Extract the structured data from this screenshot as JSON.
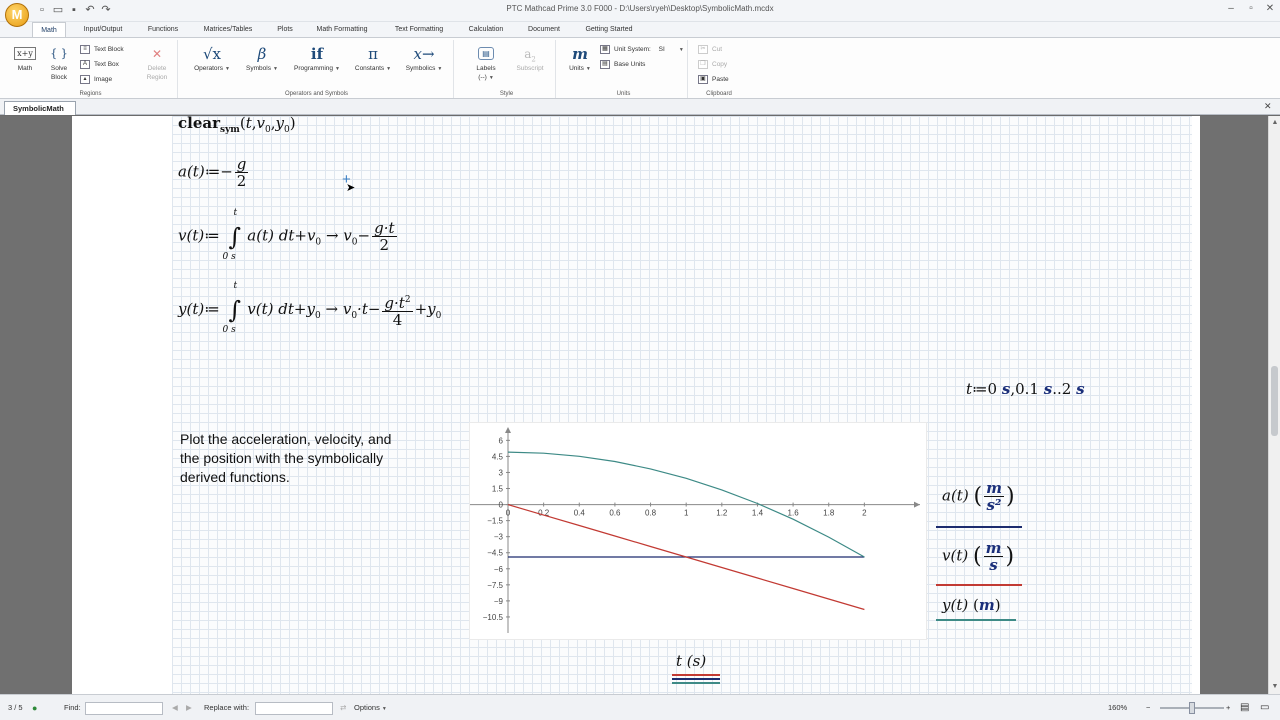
{
  "window": {
    "title": "PTC Mathcad Prime 3.0 F000 - D:\\Users\\ryeh\\Desktop\\SymbolicMath.mcdx",
    "logo": "M",
    "quick_access": [
      "new-icon",
      "open-icon",
      "save-icon",
      "undo-icon",
      "redo-icon"
    ],
    "controls": [
      "minimize-icon",
      "maximize-icon",
      "close-icon"
    ]
  },
  "ribbon_tabs": [
    "Math",
    "Input/Output",
    "Functions",
    "Matrices/Tables",
    "Plots",
    "Math Formatting",
    "Text Formatting",
    "Calculation",
    "Document",
    "Getting Started"
  ],
  "ribbon": {
    "regions": {
      "label": "Regions",
      "math": "Math",
      "solve_block": [
        "Solve",
        "Block"
      ],
      "text_block": "Text Block",
      "text_box": "Text Box",
      "image": "Image",
      "delete_region": [
        "Delete",
        "Region"
      ]
    },
    "operators": {
      "label": "Operators and Symbols",
      "operators": "Operators",
      "symbols": "Symbols",
      "programming": "Programming",
      "constants": "Constants",
      "symbolics": "Symbolics",
      "icons": {
        "operators": "√x",
        "symbols": "β",
        "programming": "if",
        "constants": "π",
        "symbolics": "x→"
      }
    },
    "style": {
      "label": "Style",
      "labels": "Labels",
      "labels_value": "(--)",
      "subscript": "Subscript"
    },
    "units": {
      "label": "Units",
      "units": "Units",
      "unit_system_label": "Unit System:",
      "unit_system_value": "SI",
      "base_units": "Base Units",
      "icon": "m"
    },
    "clipboard": {
      "label": "Clipboard",
      "cut": "Cut",
      "copy": "Copy",
      "paste": "Paste"
    }
  },
  "document_tab": "SymbolicMath",
  "worksheet": {
    "clear_sym": {
      "fn": "clear",
      "sub": "sym",
      "args": [
        "t",
        "v",
        "0",
        "y",
        "0"
      ]
    },
    "a_def": {
      "lhs": "a(t)",
      "assign": "≔",
      "sign": "−",
      "num": "g",
      "den": "2"
    },
    "v_def": {
      "lhs": "v(t)",
      "assign": "≔",
      "upper": "t",
      "lower": "0 s",
      "integrand": "a(t) dt",
      "plus": "+",
      "const": "v",
      "const_sub": "0",
      "arrow": "→",
      "res_const": "v",
      "res_const_sub": "0",
      "res_sign": "−",
      "res_num": "g·t",
      "res_den": "2"
    },
    "y_def": {
      "lhs": "y(t)",
      "assign": "≔",
      "upper": "t",
      "lower": "0 s",
      "integrand": "v(t) dt",
      "plus": "+",
      "const": "y",
      "const_sub": "0",
      "arrow": "→",
      "res_a": "v",
      "res_a_sub": "0",
      "res_a_rest": "·t",
      "res_sign": "−",
      "res_num": "g·t",
      "res_num_sup": "2",
      "res_den": "4",
      "res_plus": "+",
      "res_b": "y",
      "res_b_sub": "0"
    },
    "t_range": {
      "var": "t",
      "assign": "≔",
      "start": "0",
      "step": "0.1",
      "end": "2",
      "unit": "s",
      "sep": ",",
      "range": ".."
    },
    "note": "Plot the acceleration, velocity, and the position with the symbolically derived functions."
  },
  "chart_data": {
    "type": "line",
    "x": [
      0,
      0.2,
      0.4,
      0.6,
      0.8,
      1.0,
      1.2,
      1.4,
      1.6,
      1.8,
      2.0
    ],
    "xticks": [
      "0",
      "0.2",
      "0.4",
      "0.6",
      "0.8",
      "1",
      "1.2",
      "1.4",
      "1.6",
      "1.8",
      "2"
    ],
    "yticks": [
      "6",
      "4.5",
      "3",
      "1.5",
      "0",
      "−1.5",
      "−3",
      "−4.5",
      "−6",
      "−7.5",
      "−9",
      "−10.5"
    ],
    "xlim": [
      0,
      2.2
    ],
    "ylim": [
      -12,
      6.5
    ],
    "series": [
      {
        "name": "a(t) (m/s²)",
        "color": "#1c2b6e",
        "values": [
          -4.9,
          -4.9,
          -4.9,
          -4.9,
          -4.9,
          -4.9,
          -4.9,
          -4.9,
          -4.9,
          -4.9,
          -4.9
        ]
      },
      {
        "name": "v(t) (m/s)",
        "color": "#c23a33",
        "values": [
          0,
          -0.98,
          -1.96,
          -2.94,
          -3.92,
          -4.9,
          -5.88,
          -6.86,
          -7.84,
          -8.82,
          -9.8
        ]
      },
      {
        "name": "y(t) (m)",
        "color": "#3d8a86",
        "values": [
          4.9,
          4.8,
          4.51,
          4.02,
          3.33,
          2.45,
          1.37,
          0.1,
          -1.37,
          -3.04,
          -4.9
        ]
      }
    ],
    "xlabel": "t (s)",
    "legend": [
      {
        "fn": "a(t)",
        "unit_num": "m",
        "unit_den": "s²"
      },
      {
        "fn": "v(t)",
        "unit_num": "m",
        "unit_den": "s"
      },
      {
        "fn": "y(t)",
        "unit": "m"
      }
    ],
    "legend_position": "right",
    "grid": false
  },
  "status": {
    "page": "3 / 5",
    "find_label": "Find:",
    "replace_label": "Replace with:",
    "options": "Options",
    "zoom": "160%"
  }
}
